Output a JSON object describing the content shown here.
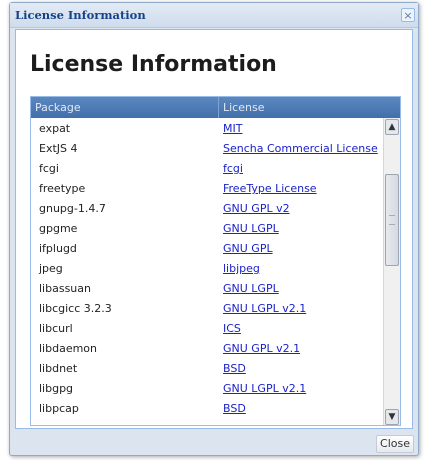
{
  "window": {
    "title": "License Information",
    "close_glyph": "×"
  },
  "heading": "License Information",
  "grid": {
    "columns": [
      "Package",
      "License"
    ],
    "rows": [
      {
        "package": "expat",
        "license": "MIT"
      },
      {
        "package": "ExtJS 4",
        "license": "Sencha Commercial License"
      },
      {
        "package": "fcgi",
        "license": "fcgi"
      },
      {
        "package": "freetype",
        "license": "FreeType License"
      },
      {
        "package": "gnupg-1.4.7",
        "license": "GNU GPL v2"
      },
      {
        "package": "gpgme",
        "license": "GNU LGPL"
      },
      {
        "package": "ifplugd",
        "license": "GNU GPL"
      },
      {
        "package": "jpeg",
        "license": "libjpeg"
      },
      {
        "package": "libassuan",
        "license": "GNU LGPL"
      },
      {
        "package": "libcgicc 3.2.3",
        "license": "GNU LGPL v2.1"
      },
      {
        "package": "libcurl",
        "license": "ICS"
      },
      {
        "package": "libdaemon",
        "license": "GNU GPL v2.1"
      },
      {
        "package": "libdnet",
        "license": "BSD"
      },
      {
        "package": "libgpg",
        "license": "GNU LGPL v2.1"
      },
      {
        "package": "libpcap",
        "license": "BSD"
      }
    ]
  },
  "scrollbar": {
    "up_glyph": "▲",
    "down_glyph": "▼"
  },
  "footer": {
    "close_label": "Close"
  },
  "background_link_fragment": "e",
  "colors": {
    "header": "#4d7bb6",
    "link": "#1b22c9",
    "title_text": "#15428b"
  }
}
